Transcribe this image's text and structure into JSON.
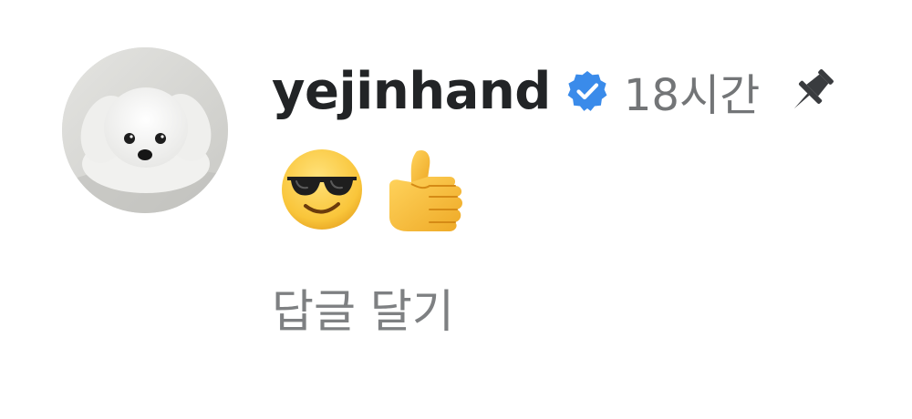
{
  "comment": {
    "username": "yejinhand",
    "verified": true,
    "timestamp": "18시간",
    "pinned": true,
    "body_emojis": [
      "smiling-face-with-sunglasses",
      "thumbs-up"
    ],
    "reply_label": "답글 달기"
  },
  "icons": {
    "verified": "verified-badge-icon",
    "pin": "pin-icon"
  },
  "colors": {
    "verified_badge": "#3a8bea",
    "username": "#222426",
    "secondary_text": "#737577"
  }
}
